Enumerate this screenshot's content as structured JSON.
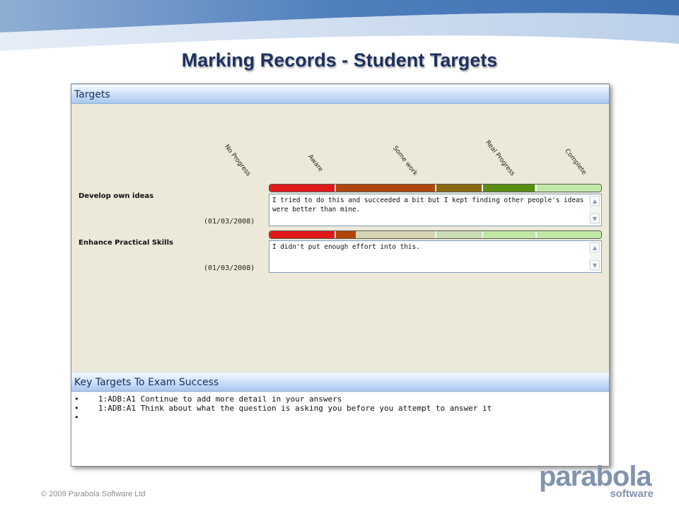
{
  "slide": {
    "title": "Marking Records - Student Targets",
    "copyright": "© 2009 Parabola Software Ltd"
  },
  "targets_panel": {
    "header": "Targets",
    "columns": [
      "No Progress",
      "Aware",
      "Some work",
      "Real Progress",
      "Complete"
    ],
    "items": [
      {
        "name": "Develop own ideas",
        "date": "(01/03/2008)",
        "progress": 0.8,
        "comment": "I tried to do this and succeeded a bit but I kept finding other people's ideas were better than mine."
      },
      {
        "name": "Enhance Practical Skills",
        "date": "(01/03/2008)",
        "progress": 0.26,
        "comment": "I didn't put enough effort into this."
      }
    ]
  },
  "key_targets_panel": {
    "header": "Key Targets To Exam Success",
    "items": [
      "1:ADB:A1 Continue to add more detail in your answers",
      "1:ADB:A1 Think about what the question is asking you before you attempt to answer it",
      ""
    ],
    "bullet": "•"
  },
  "logo": {
    "word": "parabola",
    "sub": "software"
  },
  "icons": {
    "scroll_up": "chevron-up-icon",
    "scroll_down": "chevron-down-icon"
  },
  "colors": {
    "title": "#1c3160",
    "header_gradient_top": "#f7fbff",
    "header_gradient_bottom": "#a9c7ef",
    "panel_bg": "#ece9d8",
    "progress_filled": [
      "#e0191b",
      "#b0460c",
      "#8b6a0f",
      "#5a8e12"
    ],
    "progress_empty": [
      "#e9c4b0",
      "#d8d3b3",
      "#c9dcb3",
      "#c2e8a6"
    ]
  }
}
